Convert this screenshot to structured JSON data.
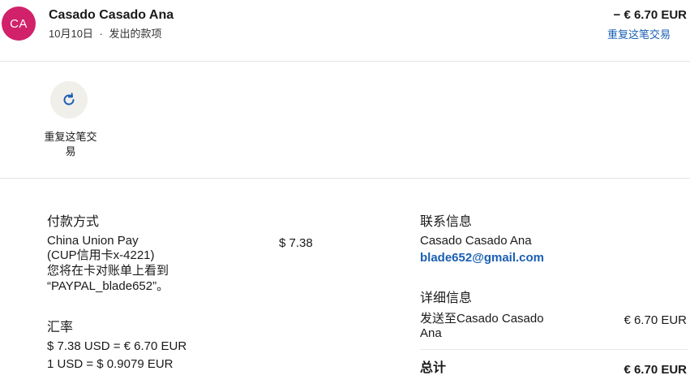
{
  "header": {
    "avatar_initials": "CA",
    "name": "Casado Casado Ana",
    "date": "10月10日",
    "separator": "·",
    "type": "发出的款项",
    "amount": "− € 6.70 EUR",
    "repeat_link": "重复这笔交易"
  },
  "actions": {
    "repeat_icon": "refresh-icon",
    "repeat_label": "重复这笔交易"
  },
  "payment": {
    "title": "付款方式",
    "method_line1": "China Union Pay",
    "method_line2": "(CUP信用卡x-4221)",
    "method_line3": "您将在卡对账单上看到",
    "method_line4": "“PAYPAL_blade652”。",
    "amount": "$ 7.38"
  },
  "exchange": {
    "title": "汇率",
    "line1": "$ 7.38 USD = € 6.70 EUR",
    "line2": "1 USD = $ 0.9079 EUR"
  },
  "contact": {
    "title": "联系信息",
    "name": "Casado Casado Ana",
    "email": "blade652@gmail.com"
  },
  "details": {
    "title": "详细信息",
    "sent_to_line1": "发送至Casado Casado",
    "sent_to_line2": "Ana",
    "sent_amount": "€ 6.70 EUR",
    "total_label": "总计",
    "total_amount": "€ 6.70 EUR"
  },
  "colors": {
    "avatar_bg": "#d1216b",
    "link": "#1a5fb4",
    "repeat_btn_bg": "#f1efea"
  }
}
